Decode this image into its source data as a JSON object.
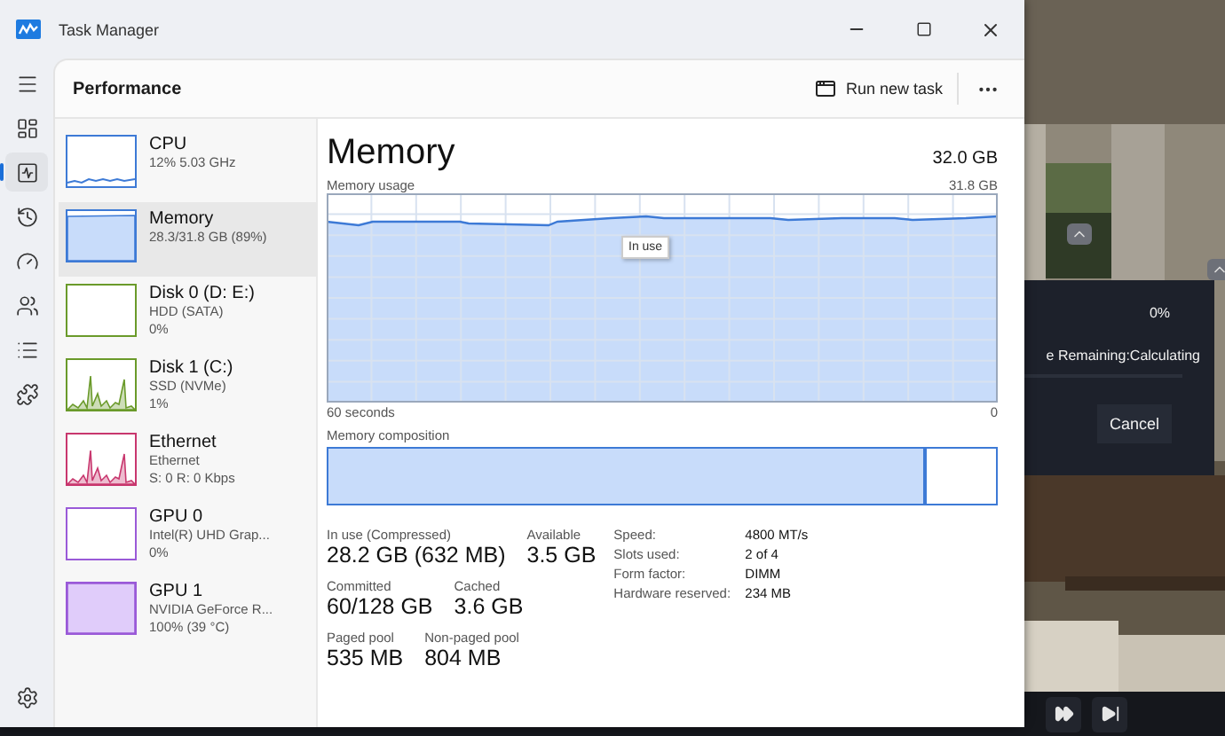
{
  "window": {
    "title": "Task Manager"
  },
  "nav": [
    {
      "kind": "menu",
      "selected": false
    },
    {
      "kind": "processes",
      "selected": false
    },
    {
      "kind": "performance",
      "selected": true
    },
    {
      "kind": "history",
      "selected": false
    },
    {
      "kind": "startup",
      "selected": false
    },
    {
      "kind": "users",
      "selected": false
    },
    {
      "kind": "details",
      "selected": false
    },
    {
      "kind": "services",
      "selected": false
    }
  ],
  "header": {
    "title": "Performance",
    "action": "Run new task"
  },
  "devices": [
    {
      "name": "CPU",
      "details": [
        "12%  5.03 GHz"
      ],
      "kind": "line",
      "color": "#3d7ad6",
      "selected": false
    },
    {
      "name": "Memory",
      "details": [
        "28.3/31.8 GB (89%)"
      ],
      "kind": "fill",
      "color": "#3d7ad6",
      "selected": true
    },
    {
      "name": "Disk 0 (D: E:)",
      "details": [
        "HDD (SATA)",
        "0%"
      ],
      "kind": "empty",
      "color": "#6a9a2a",
      "selected": false
    },
    {
      "name": "Disk 1 (C:)",
      "details": [
        "SSD (NVMe)",
        "1%"
      ],
      "kind": "spikes",
      "color": "#6a9a2a",
      "selected": false
    },
    {
      "name": "Ethernet",
      "details": [
        "Ethernet",
        "S: 0 R: 0 Kbps"
      ],
      "kind": "spikes",
      "color": "#c8376e",
      "selected": false
    },
    {
      "name": "GPU 0",
      "details": [
        "Intel(R) UHD Grap...",
        "0%"
      ],
      "kind": "empty",
      "color": "#9a5ad8",
      "selected": false
    },
    {
      "name": "GPU 1",
      "details": [
        "NVIDIA GeForce R...",
        "100% (39 °C)"
      ],
      "kind": "full",
      "color": "#9a5ad8",
      "selected": false
    }
  ],
  "detail": {
    "title": "Memory",
    "total": "32.0 GB",
    "chart_label": "Memory usage",
    "chart_max": "31.8 GB",
    "chart_start": "60 seconds",
    "chart_end": "0",
    "tooltip": "In use",
    "composition_label": "Memory composition",
    "composition": {
      "level": 0.89
    },
    "stats": [
      [
        {
          "label": "In use (Compressed)",
          "value": "28.2 GB (632 MB)"
        },
        {
          "label": "Available",
          "value": "3.5 GB"
        }
      ],
      [
        {
          "label": "Committed",
          "value": "60/128 GB"
        },
        {
          "label": "Cached",
          "value": "3.6 GB"
        }
      ],
      [
        {
          "label": "Paged pool",
          "value": "535 MB"
        },
        {
          "label": "Non-paged pool",
          "value": "804 MB"
        }
      ]
    ],
    "specs": [
      {
        "label": "Speed:",
        "value": "4800 MT/s"
      },
      {
        "label": "Slots used:",
        "value": "2 of 4"
      },
      {
        "label": "Form factor:",
        "value": "DIMM"
      },
      {
        "label": "Hardware reserved:",
        "value": "234 MB"
      }
    ]
  },
  "background_app": {
    "progress": "0%",
    "status": "e Remaining:Calculating",
    "level": 0,
    "button": "Cancel"
  }
}
